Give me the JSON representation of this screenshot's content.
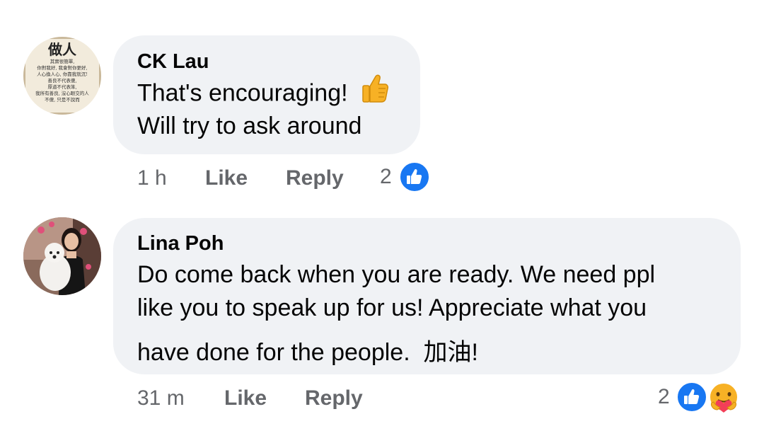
{
  "comments": [
    {
      "author": "CK Lau",
      "avatar_icon": "calligraphy-avatar-icon",
      "avatar_title": "做人",
      "avatar_lines": [
        "其實很簡單,",
        "你對我好, 我會對你更好,",
        "人心換人心, 你靠我就沉!",
        "善良不代表傻,",
        "厚道不代表笨,",
        "我所有善良, 沒心眼交的人",
        "不傻, 只是不說而"
      ],
      "text_lines": [
        "That's encouraging!",
        "Will try to ask around"
      ],
      "inline_emoji": "thumbs-up-emoji",
      "time": "1 h",
      "like_label": "Like",
      "reply_label": "Reply",
      "reaction_count": "2",
      "reactions": [
        "like-reaction-icon"
      ]
    },
    {
      "author": "Lina Poh",
      "avatar_icon": "woman-with-dog-avatar-icon",
      "text_lines": [
        "Do come back when you are ready. We need ppl",
        "like you to speak up for us! Appreciate what you",
        "have done for the people.  加油!"
      ],
      "time": "31 m",
      "like_label": "Like",
      "reply_label": "Reply",
      "reaction_count": "2",
      "reactions": [
        "like-reaction-icon",
        "care-reaction-icon"
      ]
    }
  ],
  "colors": {
    "bubble": "#f0f2f5",
    "text": "#050505",
    "meta": "#65676b",
    "like_blue": "#1877f2",
    "care_yellow": "#f7b125"
  }
}
